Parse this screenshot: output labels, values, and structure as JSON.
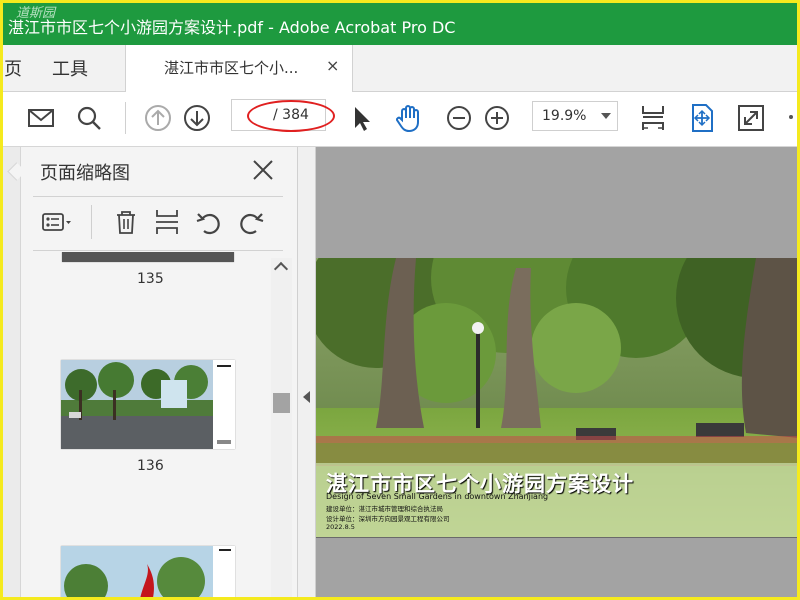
{
  "window": {
    "title": "湛江市市区七个小游园方案设计.pdf - Adobe Acrobat Pro DC",
    "watermark": "道斯园"
  },
  "menu": {
    "home": "页",
    "tools": "工具"
  },
  "tab": {
    "label": "湛江市市区七个小...",
    "close": "×"
  },
  "toolbar": {
    "page_value": "",
    "page_total": "/ 384",
    "zoom": "19.9%"
  },
  "panel": {
    "title": "页面缩略图",
    "thumbnails": [
      {
        "page": "135"
      },
      {
        "page": "136"
      }
    ]
  },
  "document": {
    "title": "湛江市市区七个小游园方案设计",
    "subtitle": "Design of Seven Small Gardens in downtown Zhanjiang",
    "build_unit": "建设单位：湛江市城市管理和综合执法局",
    "design_unit": "设计单位：深圳市方向园景观工程有限公司",
    "date": "2022.8.5"
  },
  "colors": {
    "titlebar": "#1e9a3f",
    "highlight_oval": "#e02020",
    "frame": "#f5ea1e",
    "accent_blue": "#1f6fc5"
  },
  "icons": {
    "mail": "mail-icon",
    "search": "search-icon",
    "prev": "arrow-up-circle-icon",
    "next": "arrow-down-circle-icon",
    "select": "cursor-arrow-icon",
    "hand": "hand-icon",
    "zoom_out": "zoom-out-icon",
    "zoom_in": "zoom-in-icon",
    "fit_page": "fit-page-icon",
    "scroll_mode": "scroll-mode-icon",
    "fullscreen": "fullscreen-icon"
  }
}
